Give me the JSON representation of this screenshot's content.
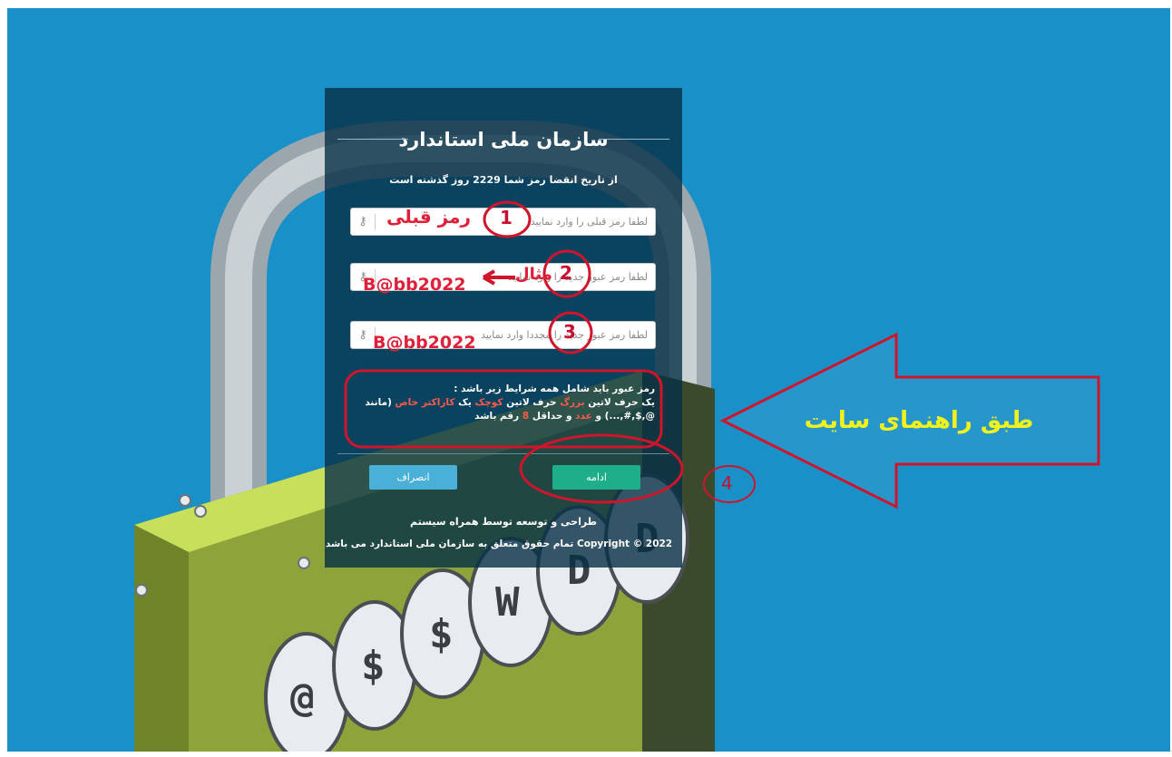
{
  "panel": {
    "title": "سازمان ملی استاندارد",
    "subtitle": "از تاریخ انقضا رمز شما 2229 روز گذشته است",
    "fields": [
      {
        "placeholder": "لطفا رمز قبلی را وارد نمایید",
        "icon": "key-icon"
      },
      {
        "placeholder": "لطفا رمز عبور جدید را وارد نمایید",
        "icon": "key-icon"
      },
      {
        "placeholder": "لطفا رمز عبور جدید را مجددا وارد نمایید",
        "icon": "key-icon"
      }
    ],
    "rules": {
      "heading": "رمز عبور باید شامل همه شرایط زیر باشد :",
      "l1": "یک حرف لاتین",
      "r1": "بزرگ",
      "l2": "حرف لاتین",
      "r2": "کوچک",
      "l3": "یک",
      "r3": "کاراکتر خاص",
      "l4": "(مانند @,$,#,...) و",
      "r4": "عدد",
      "l5": "و حداقل",
      "r5": "8",
      "l6": "رقم باشد"
    },
    "buttons": {
      "continue": "ادامه",
      "cancel": "انصراف"
    },
    "footer_design": "طراحی و توسعه توسط همراه سیستم",
    "footer_copyright": "2022 © Copyright تمام حقوق متعلق به سازمان ملی استاندارد می باشد"
  },
  "annotations": {
    "step1": "1",
    "step2": "2",
    "step3": "3",
    "step4": "4",
    "prev_password_label": "رمز قبلی",
    "example_label": "مثال",
    "example_password_1": "B@bb2022",
    "example_password_2": "B@bb2022",
    "guide_label": "طبق راهنمای سایت"
  },
  "colors": {
    "background": "#1a90c8",
    "panel": "#063046",
    "continue_button": "#1fae8a",
    "cancel_button": "#4ab0d8",
    "annotation_red": "#d0152b",
    "guide_yellow": "#f3f21a"
  }
}
